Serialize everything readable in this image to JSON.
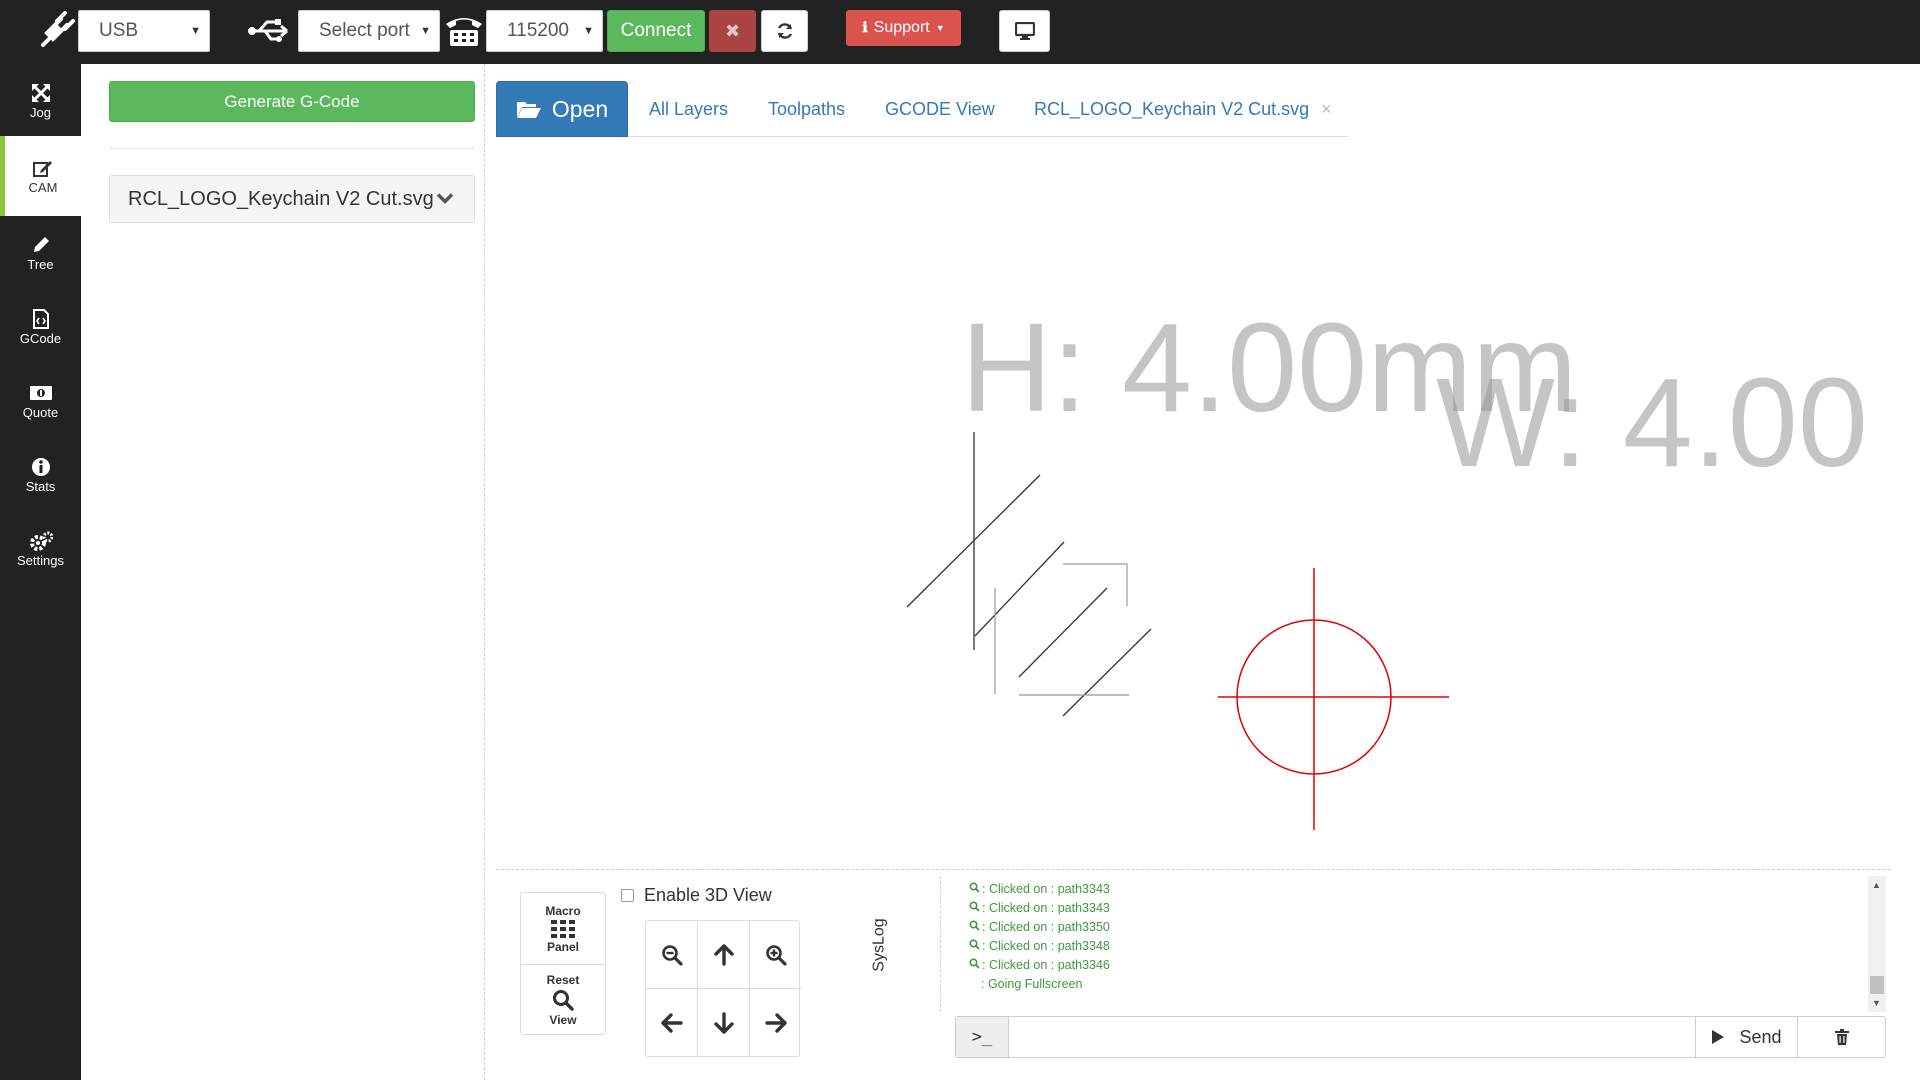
{
  "topbar": {
    "connection_type": "USB",
    "port_select": "Select port",
    "baud_rate": "115200",
    "connect_label": "Connect",
    "close_label": "✖",
    "support_label": "Support"
  },
  "sidebar": {
    "items": [
      {
        "label": "Jog",
        "icon": "arrows-icon"
      },
      {
        "label": "CAM",
        "icon": "edit-icon"
      },
      {
        "label": "Tree",
        "icon": "pencil-icon"
      },
      {
        "label": "GCode",
        "icon": "file-code-icon"
      },
      {
        "label": "Quote",
        "icon": "money-icon"
      },
      {
        "label": "Stats",
        "icon": "info-icon"
      },
      {
        "label": "Settings",
        "icon": "gears-icon"
      }
    ],
    "active": "CAM"
  },
  "cam": {
    "generate_label": "Generate G-Code",
    "file_name": "RCL_LOGO_Keychain V2 Cut.svg"
  },
  "tabs": {
    "open_label": "Open",
    "items": [
      "All Layers",
      "Toolpaths",
      "GCODE View",
      "RCL_LOGO_Keychain V2 Cut.svg"
    ],
    "close_symbol": "×"
  },
  "viewer": {
    "height_text": "H: 4.00mm",
    "width_text": "W: 4.00",
    "crosshair_color": "#e00000"
  },
  "controls": {
    "macro_line1": "Macro",
    "macro_line2": "Panel",
    "reset_line1": "Reset",
    "reset_line2": "View",
    "enable_3d_label": "Enable 3D View",
    "enable_3d_checked": false
  },
  "syslog": {
    "label": "SysLog",
    "entries": [
      ": Clicked on : path3343",
      ": Clicked on : path3343",
      ": Clicked on : path3350",
      ": Clicked on : path3348",
      ": Clicked on : path3346",
      ": Going Fullscreen"
    ]
  },
  "command": {
    "prompt": ">_",
    "input_value": "",
    "send_label": "Send"
  },
  "colors": {
    "success": "#5cb85c",
    "danger": "#d9534f",
    "primary": "#337ab7",
    "log_green": "#3c9a3c",
    "sidebar_accent": "#8dc63f"
  }
}
